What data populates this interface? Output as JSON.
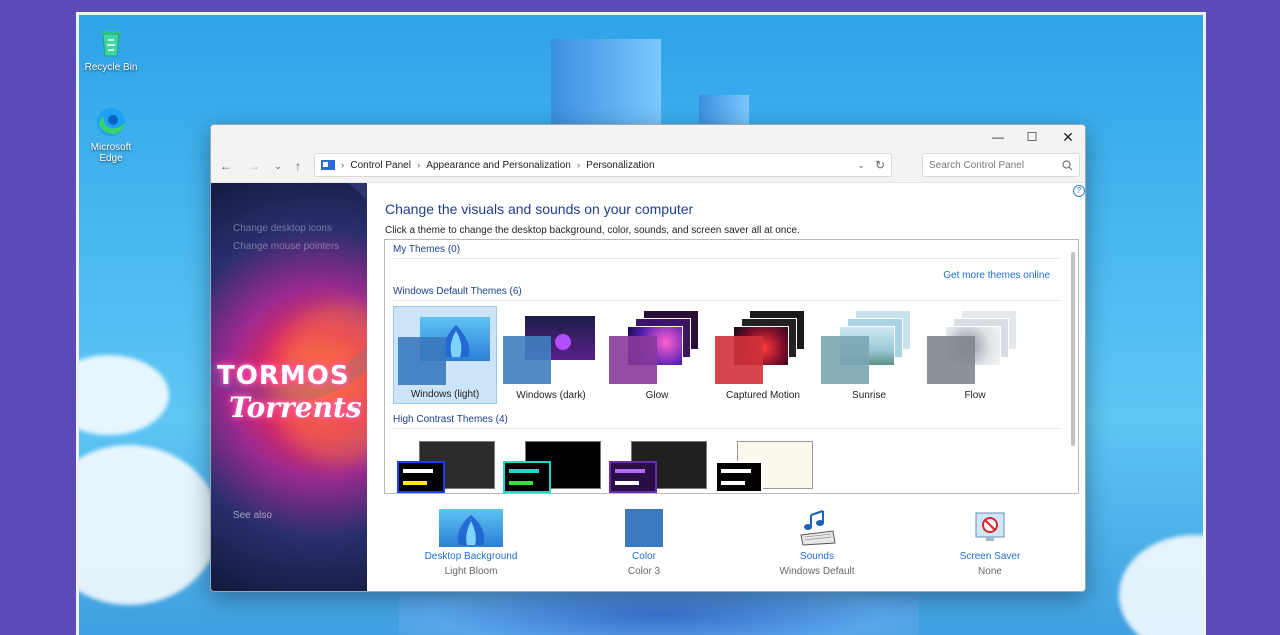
{
  "desktop": {
    "icons": [
      {
        "label": "Recycle Bin",
        "icon": "recycle-bin-icon"
      },
      {
        "label": "Microsoft Edge",
        "icon": "edge-icon"
      }
    ]
  },
  "window": {
    "breadcrumb": [
      "Control Panel",
      "Appearance and Personalization",
      "Personalization"
    ],
    "search_placeholder": "Search Control Panel",
    "sidebar": {
      "links": [
        "Change desktop icons",
        "Change mouse pointers"
      ],
      "see_also": "See also",
      "logo_top": "TORMOS",
      "logo_bottom": "Torrents"
    },
    "heading": "Change the visuals and sounds on your computer",
    "description": "Click a theme to change the desktop background, color, sounds, and screen saver all at once.",
    "my_themes": "My Themes (0)",
    "more_themes": "Get more themes online",
    "default_themes_header": "Windows Default Themes (6)",
    "default_themes": [
      {
        "name": "Windows (light)",
        "selected": true
      },
      {
        "name": "Windows (dark)"
      },
      {
        "name": "Glow"
      },
      {
        "name": "Captured Motion"
      },
      {
        "name": "Sunrise"
      },
      {
        "name": "Flow"
      }
    ],
    "high_contrast_header": "High Contrast Themes (4)",
    "bottom": [
      {
        "title": "Desktop Background",
        "value": "Light Bloom",
        "icon": "desktop-background-icon"
      },
      {
        "title": "Color",
        "value": "Color 3",
        "icon": "color-swatch-icon"
      },
      {
        "title": "Sounds",
        "value": "Windows Default",
        "icon": "music-notes-icon"
      },
      {
        "title": "Screen Saver",
        "value": "None",
        "icon": "screen-saver-icon"
      }
    ]
  }
}
